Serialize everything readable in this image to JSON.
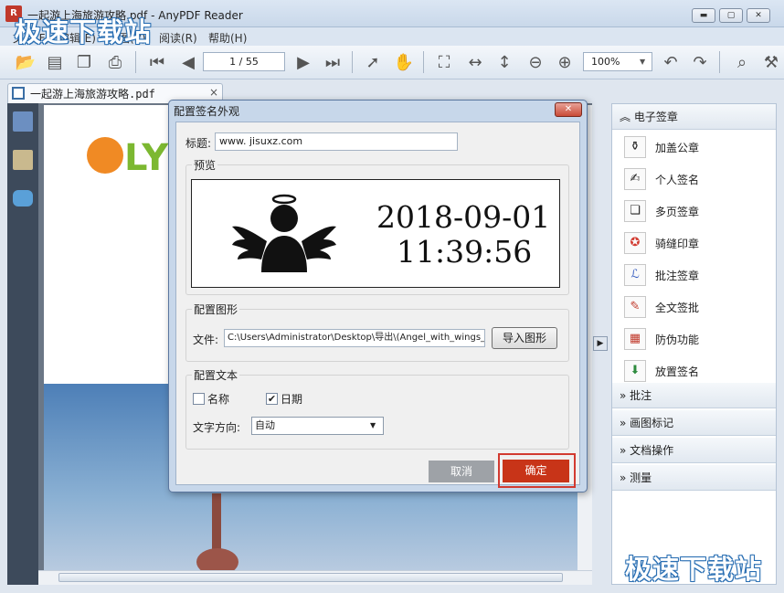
{
  "window": {
    "title": "一起游上海旅游攻略.pdf - AnyPDF Reader",
    "app_icon": "pdf-app-icon"
  },
  "menus": [
    "文件(F)",
    "编辑(E)",
    "视图(V)",
    "阅读(R)",
    "帮助(H)"
  ],
  "watermark": "极速下载站",
  "toolbar": {
    "page_indicator": "1 / 55",
    "zoom": "100%"
  },
  "doc_tab": {
    "label": "一起游上海旅游攻略.pdf",
    "close": "×"
  },
  "dialog": {
    "title": "配置签名外观",
    "close_glyph": "✕",
    "title_label": "标题:",
    "title_value": "www. jisuxz.com",
    "preview_label": "预览",
    "preview_date": "2018-09-01",
    "preview_time": "11:39:56",
    "graphic_group": "配置图形",
    "file_label": "文件:",
    "file_value": "C:\\Users\\Administrator\\Desktop\\导出\\(Angel_with_wings_",
    "import_button": "导入图形",
    "text_group": "配置文本",
    "name_checkbox": {
      "label": "名称",
      "checked": false
    },
    "date_checkbox": {
      "label": "日期",
      "checked": true
    },
    "direction_label": "文字方向:",
    "direction_value": "自动",
    "cancel_button": "取消",
    "ok_button": "确定"
  },
  "right_panel": {
    "sections": [
      {
        "label": "电子签章",
        "expanded": true
      },
      {
        "label": "批注",
        "expanded": false
      },
      {
        "label": "画图标记",
        "expanded": false
      },
      {
        "label": "文档操作",
        "expanded": false
      },
      {
        "label": "测量",
        "expanded": false
      }
    ],
    "items": [
      "加盖公章",
      "个人签名",
      "多页签章",
      "骑缝印章",
      "批注签章",
      "全文签批",
      "防伪功能",
      "放置签名"
    ],
    "expand_glyph": "»",
    "collapse_glyph": "«",
    "section_icons": [
      "chevron-up",
      "chevron-down"
    ]
  },
  "doc_logo": "LY",
  "colors": {
    "ok": "#c83418",
    "highlight": "#d23a30",
    "sky": "#4d7fb7",
    "titlebar": "#dbe6f3"
  }
}
